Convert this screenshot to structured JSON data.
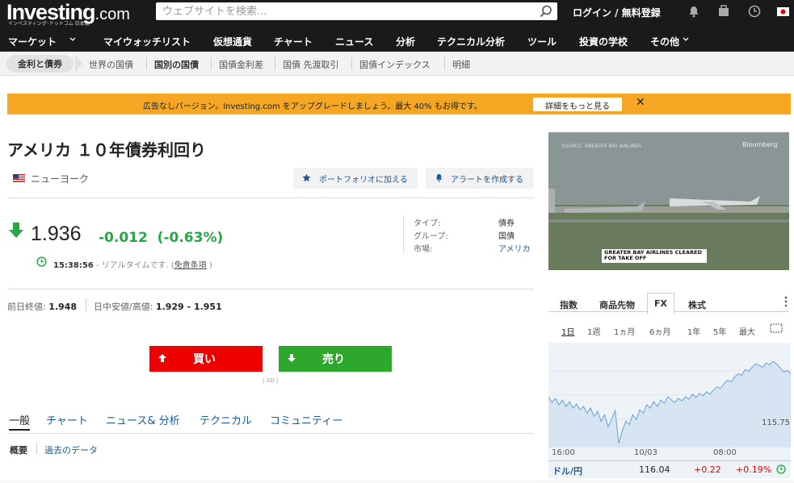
{
  "header": {
    "logo": "Investing",
    "logo_domain": ".com",
    "logo_sub": "インベスティング･ドットコム 日本版",
    "search_placeholder": "ウェブサイトを検索...",
    "login": "ログイン / 無料登録"
  },
  "nav": [
    "マーケット",
    "マイウォッチリスト",
    "仮想通貨",
    "チャート",
    "ニュース",
    "分析",
    "テクニカル分析",
    "ツール",
    "投資の学校",
    "その他"
  ],
  "subnav": [
    "金利と債券",
    "世界の国債",
    "国別の国債",
    "国債金利差",
    "国債 先渡取引",
    "国債インデックス",
    "明細"
  ],
  "banner": {
    "text": "広告なしバージョン。Investing.com をアップグレードしましょう。最大 40% もお得です。",
    "button": "詳細をもっと見る",
    "close": "✕"
  },
  "instrument": {
    "title": "アメリカ １０年債券利回り",
    "location": "ニューヨーク",
    "add_portfolio": "ポートフォリオに加える",
    "create_alert": "アラートを作成する",
    "price": "1.936",
    "change": "-0.012",
    "change_pct": "(-0.63%)",
    "time": "15:38:56",
    "time_note": " - リアルタイムです. (",
    "disclaimer": "免責条項",
    "close_paren": " )",
    "meta": [
      {
        "label": "タイプ:",
        "value": "債券"
      },
      {
        "label": "グループ:",
        "value": "国債"
      },
      {
        "label": "市場:",
        "value": "アメリカ"
      }
    ],
    "prev_close_label": "前日終値:",
    "prev_close": "1.948",
    "day_range_label": "日中安値/高値:",
    "day_range": "1.929 - 1.951",
    "buy": "買い",
    "sell": "売り",
    "ad": "| AD |"
  },
  "tabs": [
    "一般",
    "チャート",
    "ニュース& 分析",
    "テクニカル",
    "コミュニティー"
  ],
  "subtabs": [
    "概要",
    "過去のデータ"
  ],
  "video": {
    "source": "SOURCE: GREATER BAY AIRLINES",
    "brand": "Bloomberg",
    "caption_1": "GREATER BAY AIRLINES CLEARED",
    "caption_2": "FOR TAKE OFF"
  },
  "markets": {
    "tabs": [
      "指数",
      "商品先物",
      "FX",
      "株式"
    ],
    "ranges": [
      "1日",
      "1週",
      "1ヵ月",
      "6ヵ月",
      "1年",
      "5年",
      "最大"
    ],
    "xlabels": [
      "16:00",
      "10/03",
      "08:00"
    ],
    "ylabel": "115.75",
    "pair": "ドル/円",
    "last": "116.04",
    "chg": "+0.22",
    "chg_pct": "+0.19%"
  },
  "chart_data": {
    "type": "area",
    "title": "",
    "xlabel": "",
    "ylabel": "",
    "x_ticks": [
      "16:00",
      "10/03",
      "08:00"
    ],
    "y_ticks": [
      115.75
    ],
    "ylim": [
      115.3,
      116.5
    ],
    "values": [
      115.92,
      115.85,
      115.9,
      115.82,
      115.88,
      115.8,
      115.86,
      115.78,
      115.83,
      115.76,
      115.8,
      115.72,
      115.78,
      115.68,
      115.74,
      115.62,
      115.7,
      115.55,
      115.65,
      115.75,
      115.35,
      115.5,
      115.62,
      115.58,
      115.7,
      115.64,
      115.76,
      115.72,
      115.82,
      115.78,
      115.86,
      115.8,
      115.88,
      115.84,
      115.92,
      115.88,
      115.85,
      115.9,
      115.87,
      115.92,
      115.89,
      115.95,
      115.91,
      115.96,
      115.93,
      115.98,
      115.95,
      116.0,
      116.04,
      116.02,
      116.08,
      116.12,
      116.1,
      116.16,
      116.2,
      116.18,
      116.25,
      116.23,
      116.28,
      116.32,
      116.3,
      116.28,
      116.33,
      116.31,
      116.35,
      116.32,
      116.27,
      116.22,
      116.24,
      116.2
    ]
  }
}
